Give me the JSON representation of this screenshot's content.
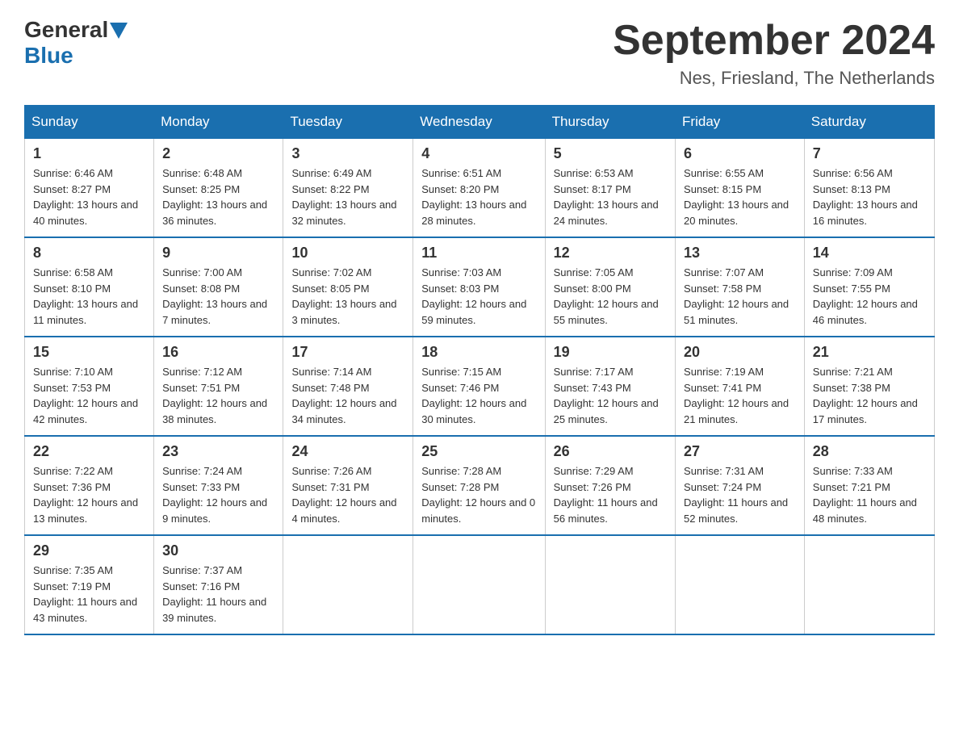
{
  "header": {
    "logo_general": "General",
    "logo_blue": "Blue",
    "month_title": "September 2024",
    "subtitle": "Nes, Friesland, The Netherlands"
  },
  "days_of_week": [
    "Sunday",
    "Monday",
    "Tuesday",
    "Wednesday",
    "Thursday",
    "Friday",
    "Saturday"
  ],
  "weeks": [
    [
      {
        "day": "1",
        "info": "Sunrise: 6:46 AM\nSunset: 8:27 PM\nDaylight: 13 hours\nand 40 minutes."
      },
      {
        "day": "2",
        "info": "Sunrise: 6:48 AM\nSunset: 8:25 PM\nDaylight: 13 hours\nand 36 minutes."
      },
      {
        "day": "3",
        "info": "Sunrise: 6:49 AM\nSunset: 8:22 PM\nDaylight: 13 hours\nand 32 minutes."
      },
      {
        "day": "4",
        "info": "Sunrise: 6:51 AM\nSunset: 8:20 PM\nDaylight: 13 hours\nand 28 minutes."
      },
      {
        "day": "5",
        "info": "Sunrise: 6:53 AM\nSunset: 8:17 PM\nDaylight: 13 hours\nand 24 minutes."
      },
      {
        "day": "6",
        "info": "Sunrise: 6:55 AM\nSunset: 8:15 PM\nDaylight: 13 hours\nand 20 minutes."
      },
      {
        "day": "7",
        "info": "Sunrise: 6:56 AM\nSunset: 8:13 PM\nDaylight: 13 hours\nand 16 minutes."
      }
    ],
    [
      {
        "day": "8",
        "info": "Sunrise: 6:58 AM\nSunset: 8:10 PM\nDaylight: 13 hours\nand 11 minutes."
      },
      {
        "day": "9",
        "info": "Sunrise: 7:00 AM\nSunset: 8:08 PM\nDaylight: 13 hours\nand 7 minutes."
      },
      {
        "day": "10",
        "info": "Sunrise: 7:02 AM\nSunset: 8:05 PM\nDaylight: 13 hours\nand 3 minutes."
      },
      {
        "day": "11",
        "info": "Sunrise: 7:03 AM\nSunset: 8:03 PM\nDaylight: 12 hours\nand 59 minutes."
      },
      {
        "day": "12",
        "info": "Sunrise: 7:05 AM\nSunset: 8:00 PM\nDaylight: 12 hours\nand 55 minutes."
      },
      {
        "day": "13",
        "info": "Sunrise: 7:07 AM\nSunset: 7:58 PM\nDaylight: 12 hours\nand 51 minutes."
      },
      {
        "day": "14",
        "info": "Sunrise: 7:09 AM\nSunset: 7:55 PM\nDaylight: 12 hours\nand 46 minutes."
      }
    ],
    [
      {
        "day": "15",
        "info": "Sunrise: 7:10 AM\nSunset: 7:53 PM\nDaylight: 12 hours\nand 42 minutes."
      },
      {
        "day": "16",
        "info": "Sunrise: 7:12 AM\nSunset: 7:51 PM\nDaylight: 12 hours\nand 38 minutes."
      },
      {
        "day": "17",
        "info": "Sunrise: 7:14 AM\nSunset: 7:48 PM\nDaylight: 12 hours\nand 34 minutes."
      },
      {
        "day": "18",
        "info": "Sunrise: 7:15 AM\nSunset: 7:46 PM\nDaylight: 12 hours\nand 30 minutes."
      },
      {
        "day": "19",
        "info": "Sunrise: 7:17 AM\nSunset: 7:43 PM\nDaylight: 12 hours\nand 25 minutes."
      },
      {
        "day": "20",
        "info": "Sunrise: 7:19 AM\nSunset: 7:41 PM\nDaylight: 12 hours\nand 21 minutes."
      },
      {
        "day": "21",
        "info": "Sunrise: 7:21 AM\nSunset: 7:38 PM\nDaylight: 12 hours\nand 17 minutes."
      }
    ],
    [
      {
        "day": "22",
        "info": "Sunrise: 7:22 AM\nSunset: 7:36 PM\nDaylight: 12 hours\nand 13 minutes."
      },
      {
        "day": "23",
        "info": "Sunrise: 7:24 AM\nSunset: 7:33 PM\nDaylight: 12 hours\nand 9 minutes."
      },
      {
        "day": "24",
        "info": "Sunrise: 7:26 AM\nSunset: 7:31 PM\nDaylight: 12 hours\nand 4 minutes."
      },
      {
        "day": "25",
        "info": "Sunrise: 7:28 AM\nSunset: 7:28 PM\nDaylight: 12 hours\nand 0 minutes."
      },
      {
        "day": "26",
        "info": "Sunrise: 7:29 AM\nSunset: 7:26 PM\nDaylight: 11 hours\nand 56 minutes."
      },
      {
        "day": "27",
        "info": "Sunrise: 7:31 AM\nSunset: 7:24 PM\nDaylight: 11 hours\nand 52 minutes."
      },
      {
        "day": "28",
        "info": "Sunrise: 7:33 AM\nSunset: 7:21 PM\nDaylight: 11 hours\nand 48 minutes."
      }
    ],
    [
      {
        "day": "29",
        "info": "Sunrise: 7:35 AM\nSunset: 7:19 PM\nDaylight: 11 hours\nand 43 minutes."
      },
      {
        "day": "30",
        "info": "Sunrise: 7:37 AM\nSunset: 7:16 PM\nDaylight: 11 hours\nand 39 minutes."
      },
      {
        "day": "",
        "info": ""
      },
      {
        "day": "",
        "info": ""
      },
      {
        "day": "",
        "info": ""
      },
      {
        "day": "",
        "info": ""
      },
      {
        "day": "",
        "info": ""
      }
    ]
  ]
}
